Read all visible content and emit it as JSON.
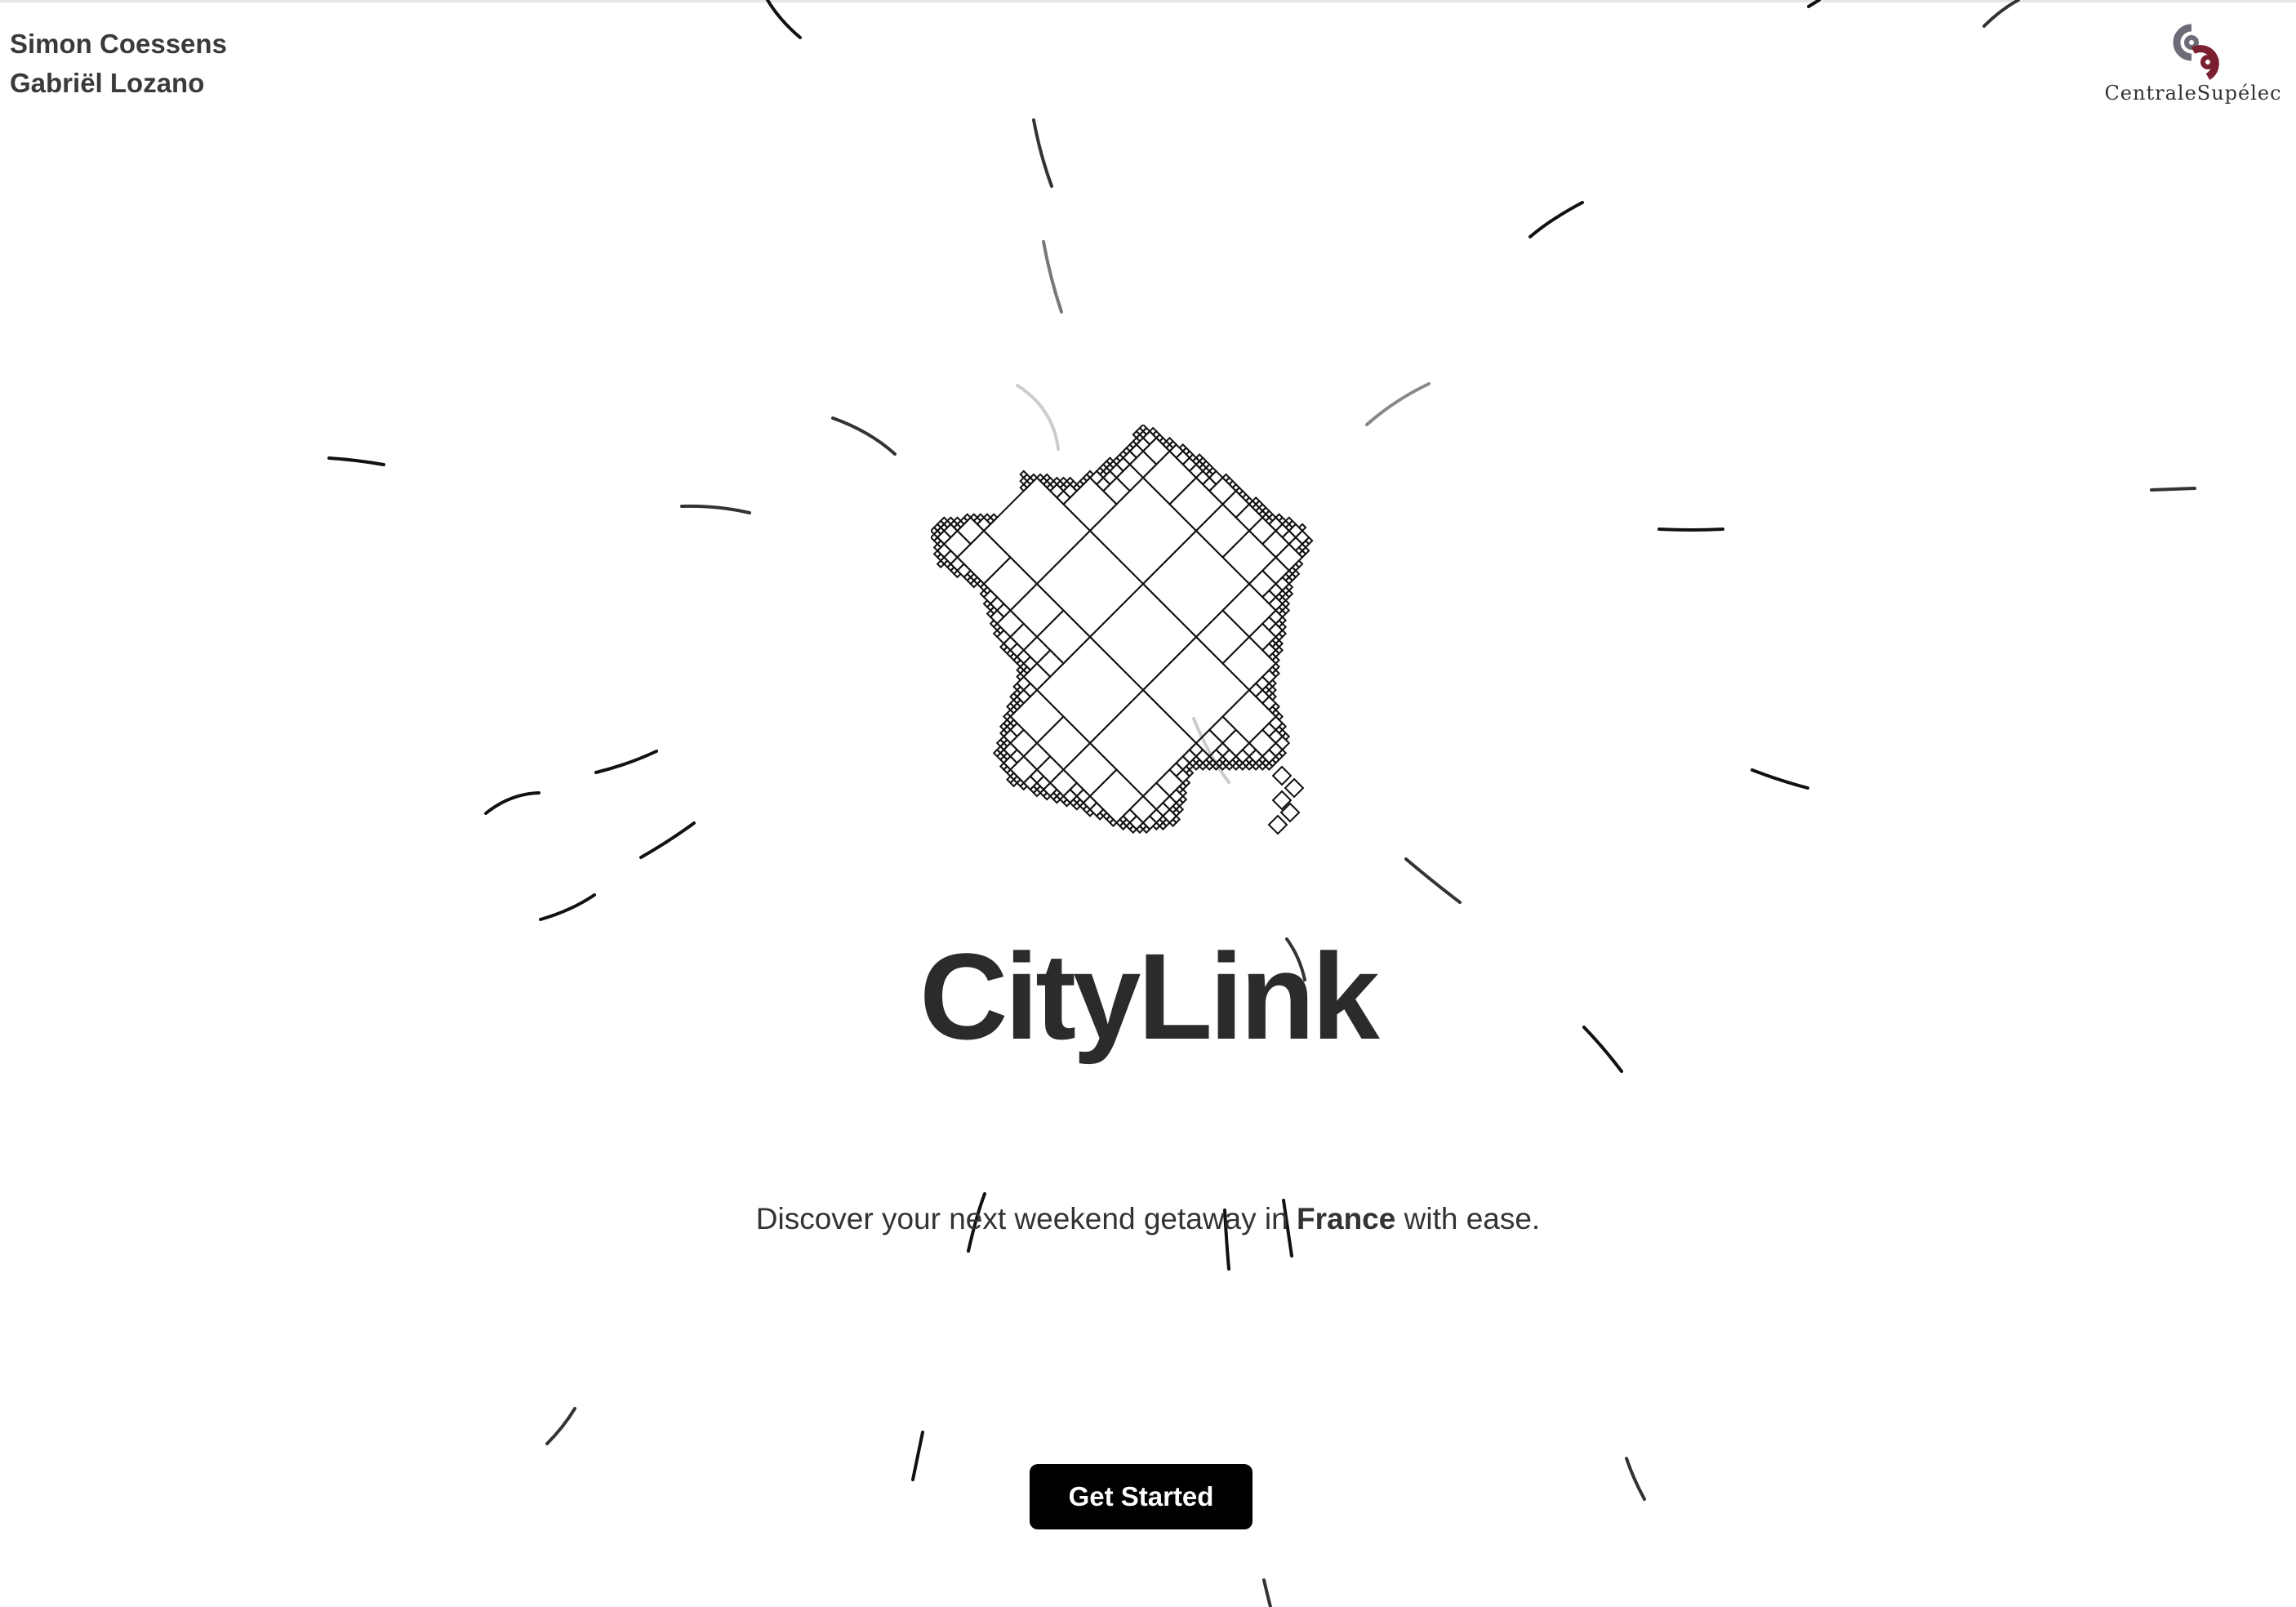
{
  "authors": [
    "Simon Coessens",
    "Gabriël Lozano"
  ],
  "school": {
    "name": "CentraleSupélec",
    "logo_icon": "centralesupelec-logo-icon"
  },
  "hero": {
    "map_icon": "france-map-icon",
    "title": "CityLink",
    "tagline_before": "Discover your next weekend getaway in ",
    "tagline_emphasis": "France",
    "tagline_after": " with ease."
  },
  "cta": {
    "label": "Get Started"
  },
  "colors": {
    "background": "#ffffff",
    "text": "#2b2b2b",
    "button_bg": "#000000",
    "button_text": "#ffffff",
    "logo_gray": "#6c6c78",
    "logo_red": "#7a2030"
  }
}
